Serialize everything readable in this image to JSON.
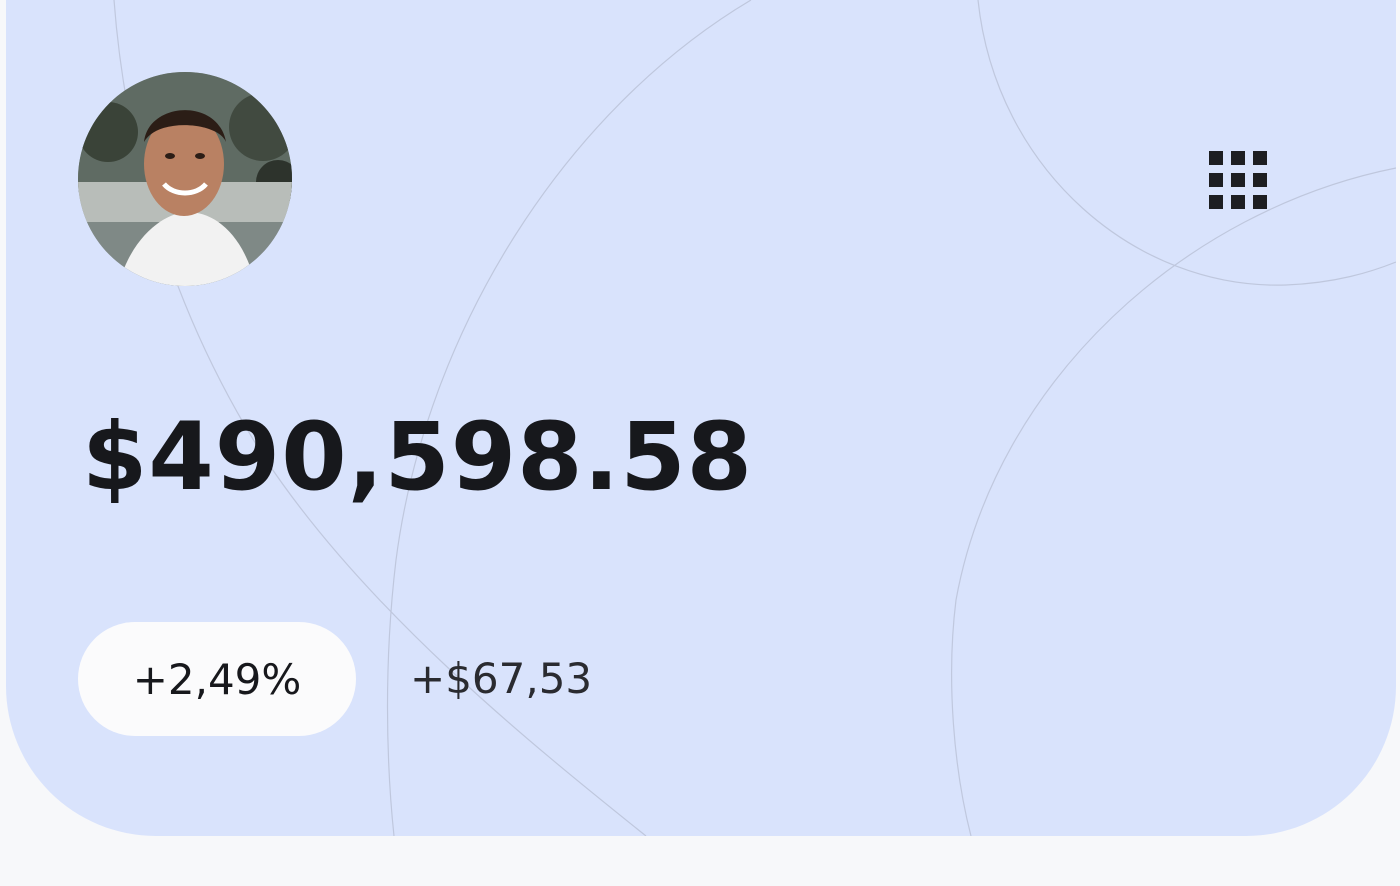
{
  "card": {
    "balance": "$490,598.58",
    "change_percent": "+2,49%",
    "change_amount": "+$67,53",
    "background_color": "#d9e3fc",
    "text_color": "#17181c"
  },
  "header": {
    "avatar_icon": "user-avatar-photo",
    "menu_icon": "grid-icon"
  }
}
